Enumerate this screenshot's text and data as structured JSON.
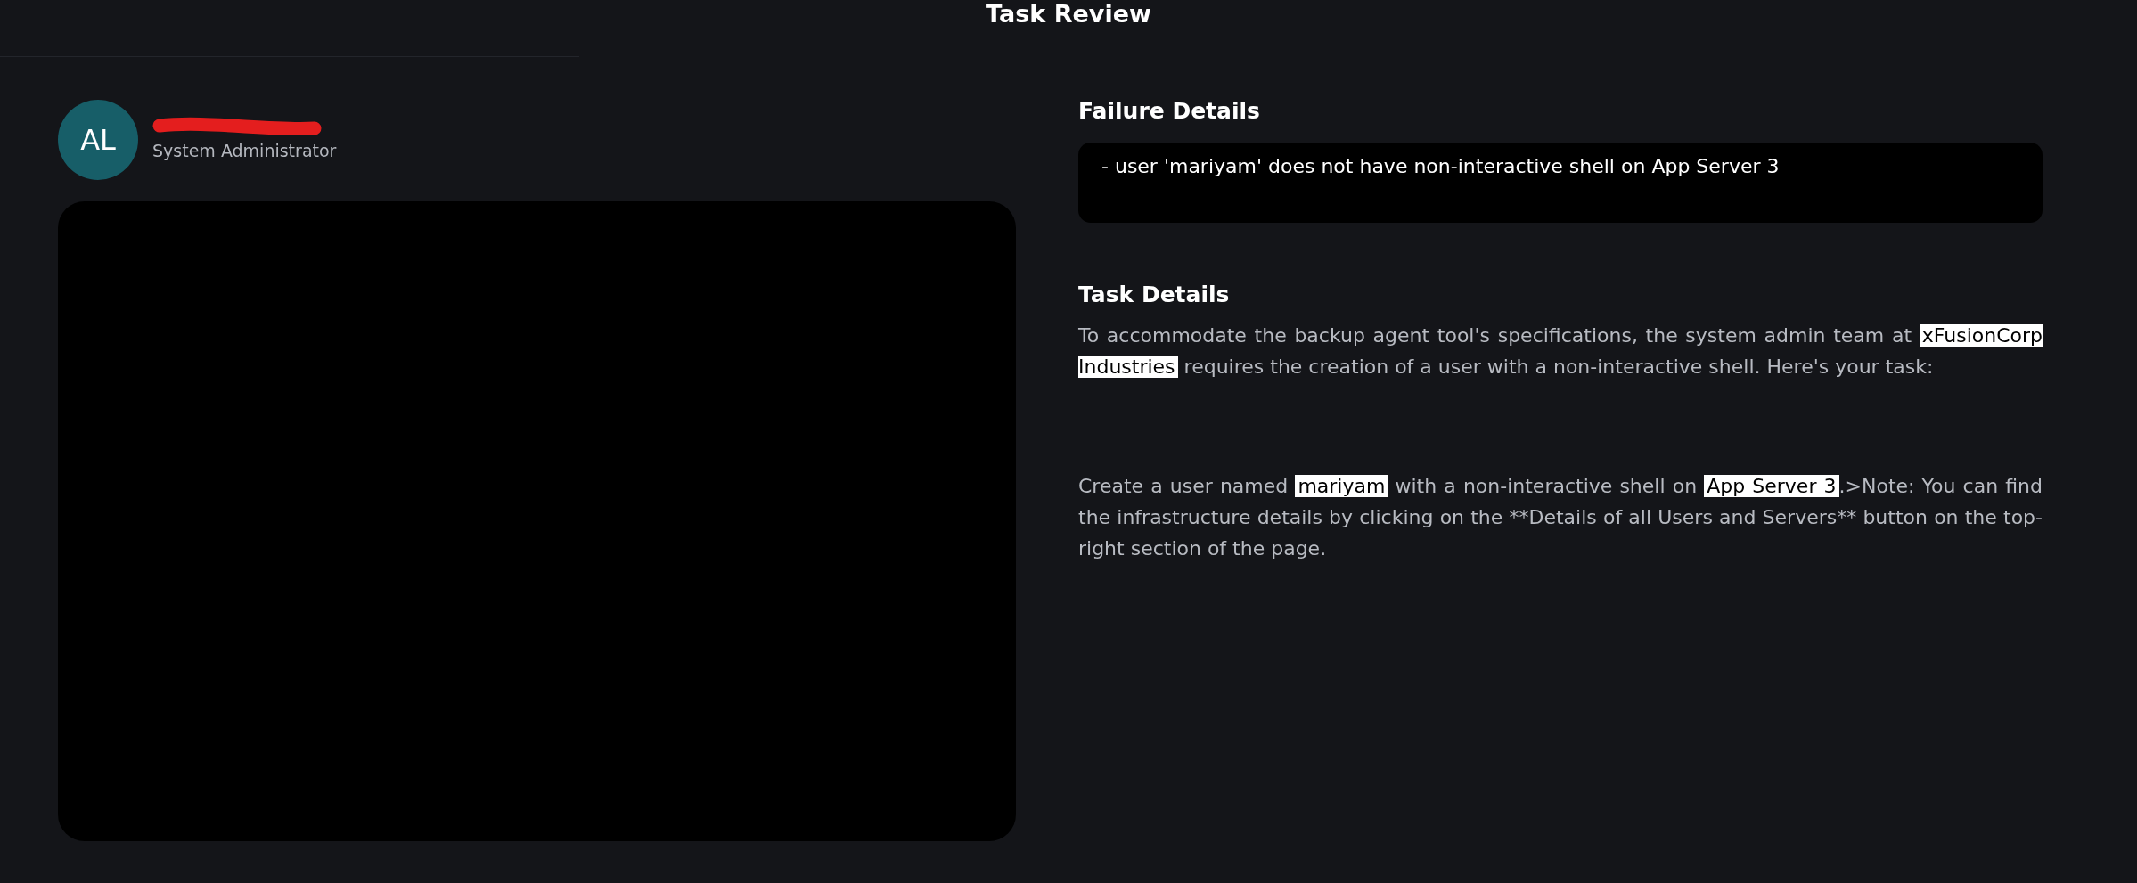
{
  "header": {
    "title": "Task Review"
  },
  "profile": {
    "initials": "AL",
    "role": "System Administrator"
  },
  "failure_details": {
    "heading": "Failure Details",
    "messages": [
      "- user 'mariyam' does not have non-interactive shell on App Server 3"
    ]
  },
  "task_details": {
    "heading": "Task Details",
    "paragraphs": [
      [
        {
          "text": "To accommodate the backup agent tool's specifications, the system admin team at ",
          "highlight": false
        },
        {
          "text": "xFusionCorp Industries",
          "highlight": true
        },
        {
          "text": " requires the creation of a user with a non-interactive shell. Here's your task:",
          "highlight": false
        }
      ],
      [
        {
          "text": "Create a user named ",
          "highlight": false
        },
        {
          "text": "mariyam",
          "highlight": true
        },
        {
          "text": " with a non-interactive shell on ",
          "highlight": false
        },
        {
          "text": "App Server 3",
          "highlight": true
        },
        {
          "text": ".>Note: You can find the infrastructure details by clicking on the **Details of all Users and Servers** button on the top-right section of the page.",
          "highlight": false
        }
      ]
    ]
  }
}
